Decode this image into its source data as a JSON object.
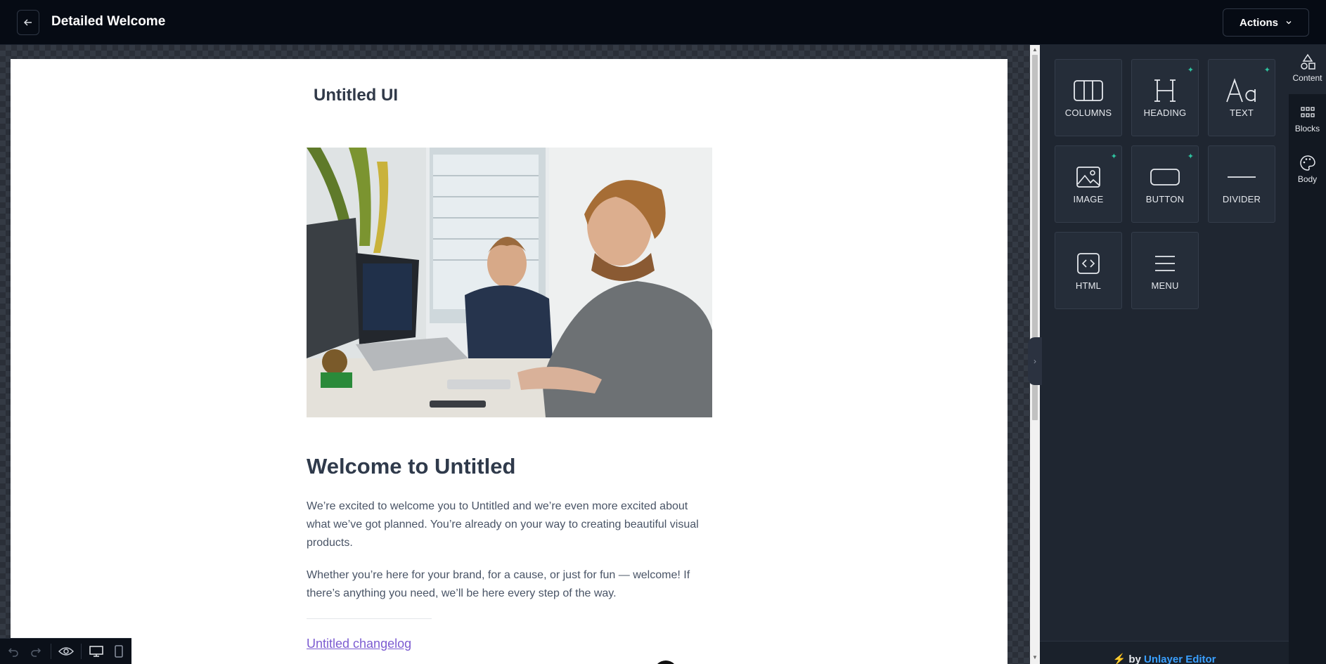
{
  "header": {
    "title": "Detailed Welcome",
    "actions_label": "Actions"
  },
  "email": {
    "brand": "Untitled UI",
    "heading": "Welcome to Untitled",
    "paragraph1": "We’re excited to welcome you to Untitled and we’re even more excited about what we’ve got planned. You’re already on your way to creating beautiful visual products.",
    "paragraph2": "Whether you’re here for your brand, for a cause, or just for fun — welcome! If there’s anything you need, we’ll be here every step of the way.",
    "changelog_link": "Untitled changelog"
  },
  "tiles": [
    {
      "label": "COLUMNS",
      "icon": "columns-icon",
      "ai": false
    },
    {
      "label": "HEADING",
      "icon": "heading-icon",
      "ai": true
    },
    {
      "label": "TEXT",
      "icon": "text-icon",
      "ai": true
    },
    {
      "label": "IMAGE",
      "icon": "image-icon",
      "ai": true
    },
    {
      "label": "BUTTON",
      "icon": "button-icon",
      "ai": true
    },
    {
      "label": "DIVIDER",
      "icon": "divider-icon",
      "ai": false
    },
    {
      "label": "HTML",
      "icon": "html-icon",
      "ai": false
    },
    {
      "label": "MENU",
      "icon": "menu-icon",
      "ai": false
    }
  ],
  "rail": {
    "content": "Content",
    "blocks": "Blocks",
    "body": "Body"
  },
  "footer": {
    "by": "by",
    "brand": "Unlayer Editor"
  },
  "colors": {
    "accent_ai": "#2ec4a0",
    "link": "#7c5cd1",
    "footer_link": "#3aa0ff"
  }
}
